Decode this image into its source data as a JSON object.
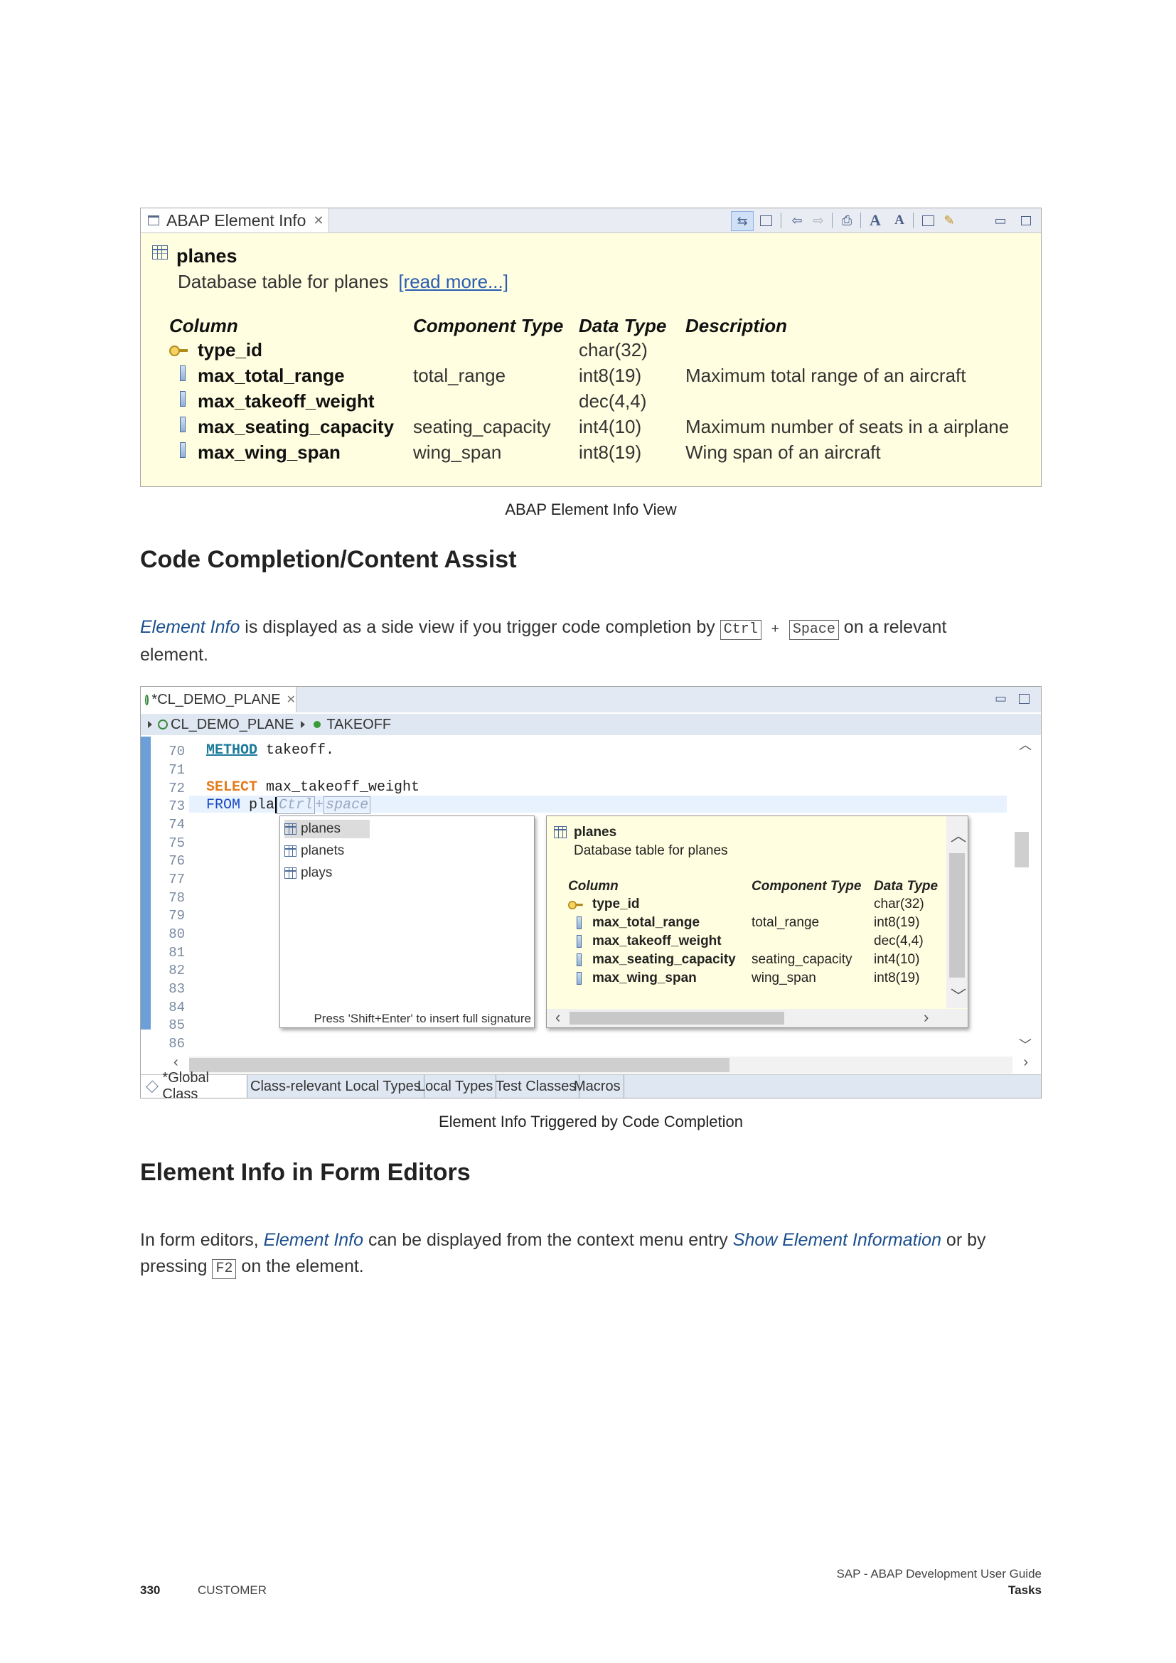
{
  "figure1": {
    "tab_title": "ABAP Element Info",
    "element_name": "planes",
    "element_description": "Database table for planes",
    "read_more": "[read more...]",
    "headers": [
      "Column",
      "Component Type",
      "Data Type",
      "Description"
    ],
    "rows": [
      {
        "column": "type_id",
        "component": "",
        "datatype": "char(32)",
        "description": "",
        "key": true
      },
      {
        "column": "max_total_range",
        "component": "total_range",
        "datatype": "int8(19)",
        "description": "Maximum total range of an aircraft",
        "key": false
      },
      {
        "column": "max_takeoff_weight",
        "component": "",
        "datatype": "dec(4,4)",
        "description": "",
        "key": false
      },
      {
        "column": "max_seating_capacity",
        "component": "seating_capacity",
        "datatype": "int4(10)",
        "description": "Maximum number of seats in a airplane",
        "key": false
      },
      {
        "column": "max_wing_span",
        "component": "wing_span",
        "datatype": "int8(19)",
        "description": "Wing span of an aircraft",
        "key": false
      }
    ],
    "caption": "ABAP Element Info View"
  },
  "section1": {
    "heading": "Code Completion/Content Assist",
    "p_link": "Element Info",
    "p_text1": " is displayed as a side view if you trigger code completion by ",
    "key1": "Ctrl",
    "plus": "+",
    "key2": "Space",
    "p_text2": " on a relevant",
    "p_text3": "element."
  },
  "figure2": {
    "tab_title": "*CL_DEMO_PLANE",
    "breadcrumb_class": "CL_DEMO_PLANE",
    "breadcrumb_method": "TAKEOFF",
    "line_numbers": [
      "70",
      "71",
      "72",
      "73",
      "74",
      "75",
      "76",
      "77",
      "78",
      "79",
      "80",
      "81",
      "82",
      "83",
      "84",
      "85",
      "86"
    ],
    "code": {
      "l70_kw": "METHOD",
      "l70_rest": " takeoff.",
      "l72_kw": "SELECT",
      "l72_rest": " max_takeoff_weight",
      "l73_kw": "FROM",
      "l73_rest": " pla",
      "ghost_ctrl": "Ctrl",
      "ghost_plus": "+",
      "ghost_space": "space"
    },
    "proposals": [
      "planes",
      "planets",
      "plays"
    ],
    "proposal_hint": "Press 'Shift+Enter' to insert full signature",
    "info": {
      "name": "planes",
      "description": "Database table for planes",
      "headers": [
        "Column",
        "Component Type",
        "Data Type"
      ],
      "rows": [
        {
          "column": "type_id",
          "component": "",
          "datatype": "char(32)"
        },
        {
          "column": "max_total_range",
          "component": "total_range",
          "datatype": "int8(19)"
        },
        {
          "column": "max_takeoff_weight",
          "component": "",
          "datatype": "dec(4,4)"
        },
        {
          "column": "max_seating_capacity",
          "component": "seating_capacity",
          "datatype": "int4(10)"
        },
        {
          "column": "max_wing_span",
          "component": "wing_span",
          "datatype": "int8(19)"
        }
      ]
    },
    "bottom_tabs": [
      "*Global Class",
      "Class-relevant Local Types",
      "Local Types",
      "Test Classes",
      "Macros"
    ],
    "caption": "Element Info Triggered by Code Completion"
  },
  "section2": {
    "heading": "Element Info in Form Editors",
    "p_text1": "In form editors, ",
    "p_link1": "Element Info",
    "p_text2": " can be displayed from the context menu entry ",
    "p_link2": "Show Element Information",
    "p_text3": " or by",
    "p_text4": "pressing ",
    "key": "F2",
    "p_text5": " on the element."
  },
  "footer": {
    "page_number": "330",
    "classification": "CUSTOMER",
    "doc_title": "SAP - ABAP Development User Guide",
    "section": "Tasks"
  }
}
